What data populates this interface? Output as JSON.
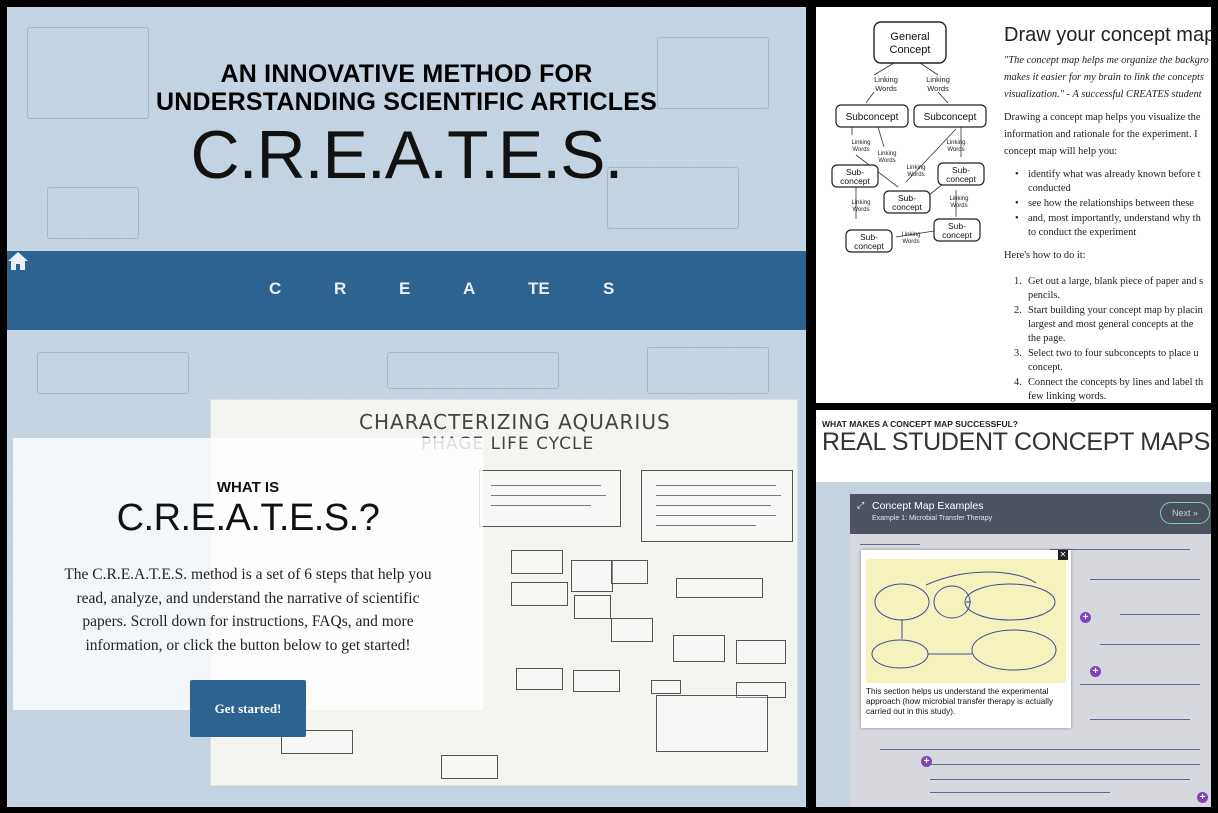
{
  "left_panel": {
    "hero_line1": "AN INNOVATIVE METHOD FOR",
    "hero_line2": "UNDERSTANDING SCIENTIFIC ARTICLES",
    "hero_brand": "C.R.E.A.T.E.S.",
    "nav": {
      "home_icon": "home-icon",
      "items": [
        "C",
        "R",
        "E",
        "A",
        "TE",
        "S"
      ]
    },
    "drawing": {
      "title_line1": "CHARACTERIZING AQUARIUS",
      "title_line2": "PHAGE LIFE CYCLE"
    },
    "card": {
      "kicker": "WHAT IS",
      "brand": "C.R.E.A.T.E.S.?",
      "description_lines": [
        "The C.R.E.A.T.E.S. method is a set of 6 steps that help you",
        "read, analyze, and understand the narrative of scientific",
        "papers. Scroll down for instructions, FAQs, and more",
        "information, or click the button below to get started!"
      ],
      "button_label": "Get started!"
    },
    "colors": {
      "nav_bg": "#2d6391",
      "background": "#c4d3e2"
    }
  },
  "top_right_panel": {
    "concept_map": {
      "general": [
        "General",
        "Concept"
      ],
      "linking": [
        "Linking",
        "Words"
      ],
      "subconcept": "Subconcept",
      "sub": [
        "Sub-",
        "concept"
      ]
    },
    "title": "Draw your concept map",
    "quote_lines": [
      "\"The concept map helps me organize the backgro",
      "makes it easier for my brain to link the concepts",
      "visualization.\" - A successful CREATES student"
    ],
    "intro_lines": [
      "Drawing a concept map helps you visualize the",
      "information and rationale for the experiment. I",
      "concept map will help you:"
    ],
    "bullets": [
      [
        "identify what was already known before t",
        "conducted"
      ],
      [
        "see how the relationships between these"
      ],
      [
        "and, most importantly, understand why th",
        "to conduct the experiment"
      ]
    ],
    "how_to": "Here's how to do it:",
    "steps": [
      [
        "Get out a large, blank piece of paper and s",
        "pencils."
      ],
      [
        "Start building your concept map by placin",
        "largest and most general concepts at the",
        "the page."
      ],
      [
        "Select two to four subconcepts to place u",
        "concept."
      ],
      [
        "Connect the concepts by lines and label th",
        "few linking words."
      ]
    ]
  },
  "bottom_right_panel": {
    "kicker": "WHAT MAKES A CONCEPT MAP SUCCESSFUL?",
    "title": "REAL STUDENT CONCEPT MAPS",
    "viewer": {
      "title": "Concept Map Examples",
      "subtitle": "Example 1: Microbial Transfer Therapy",
      "next_label": "Next »",
      "popup_caption_lines": [
        "This section helps us understand the experimental",
        "approach (how microbial transfer therapy is actually",
        "carried out in this study)."
      ]
    }
  }
}
